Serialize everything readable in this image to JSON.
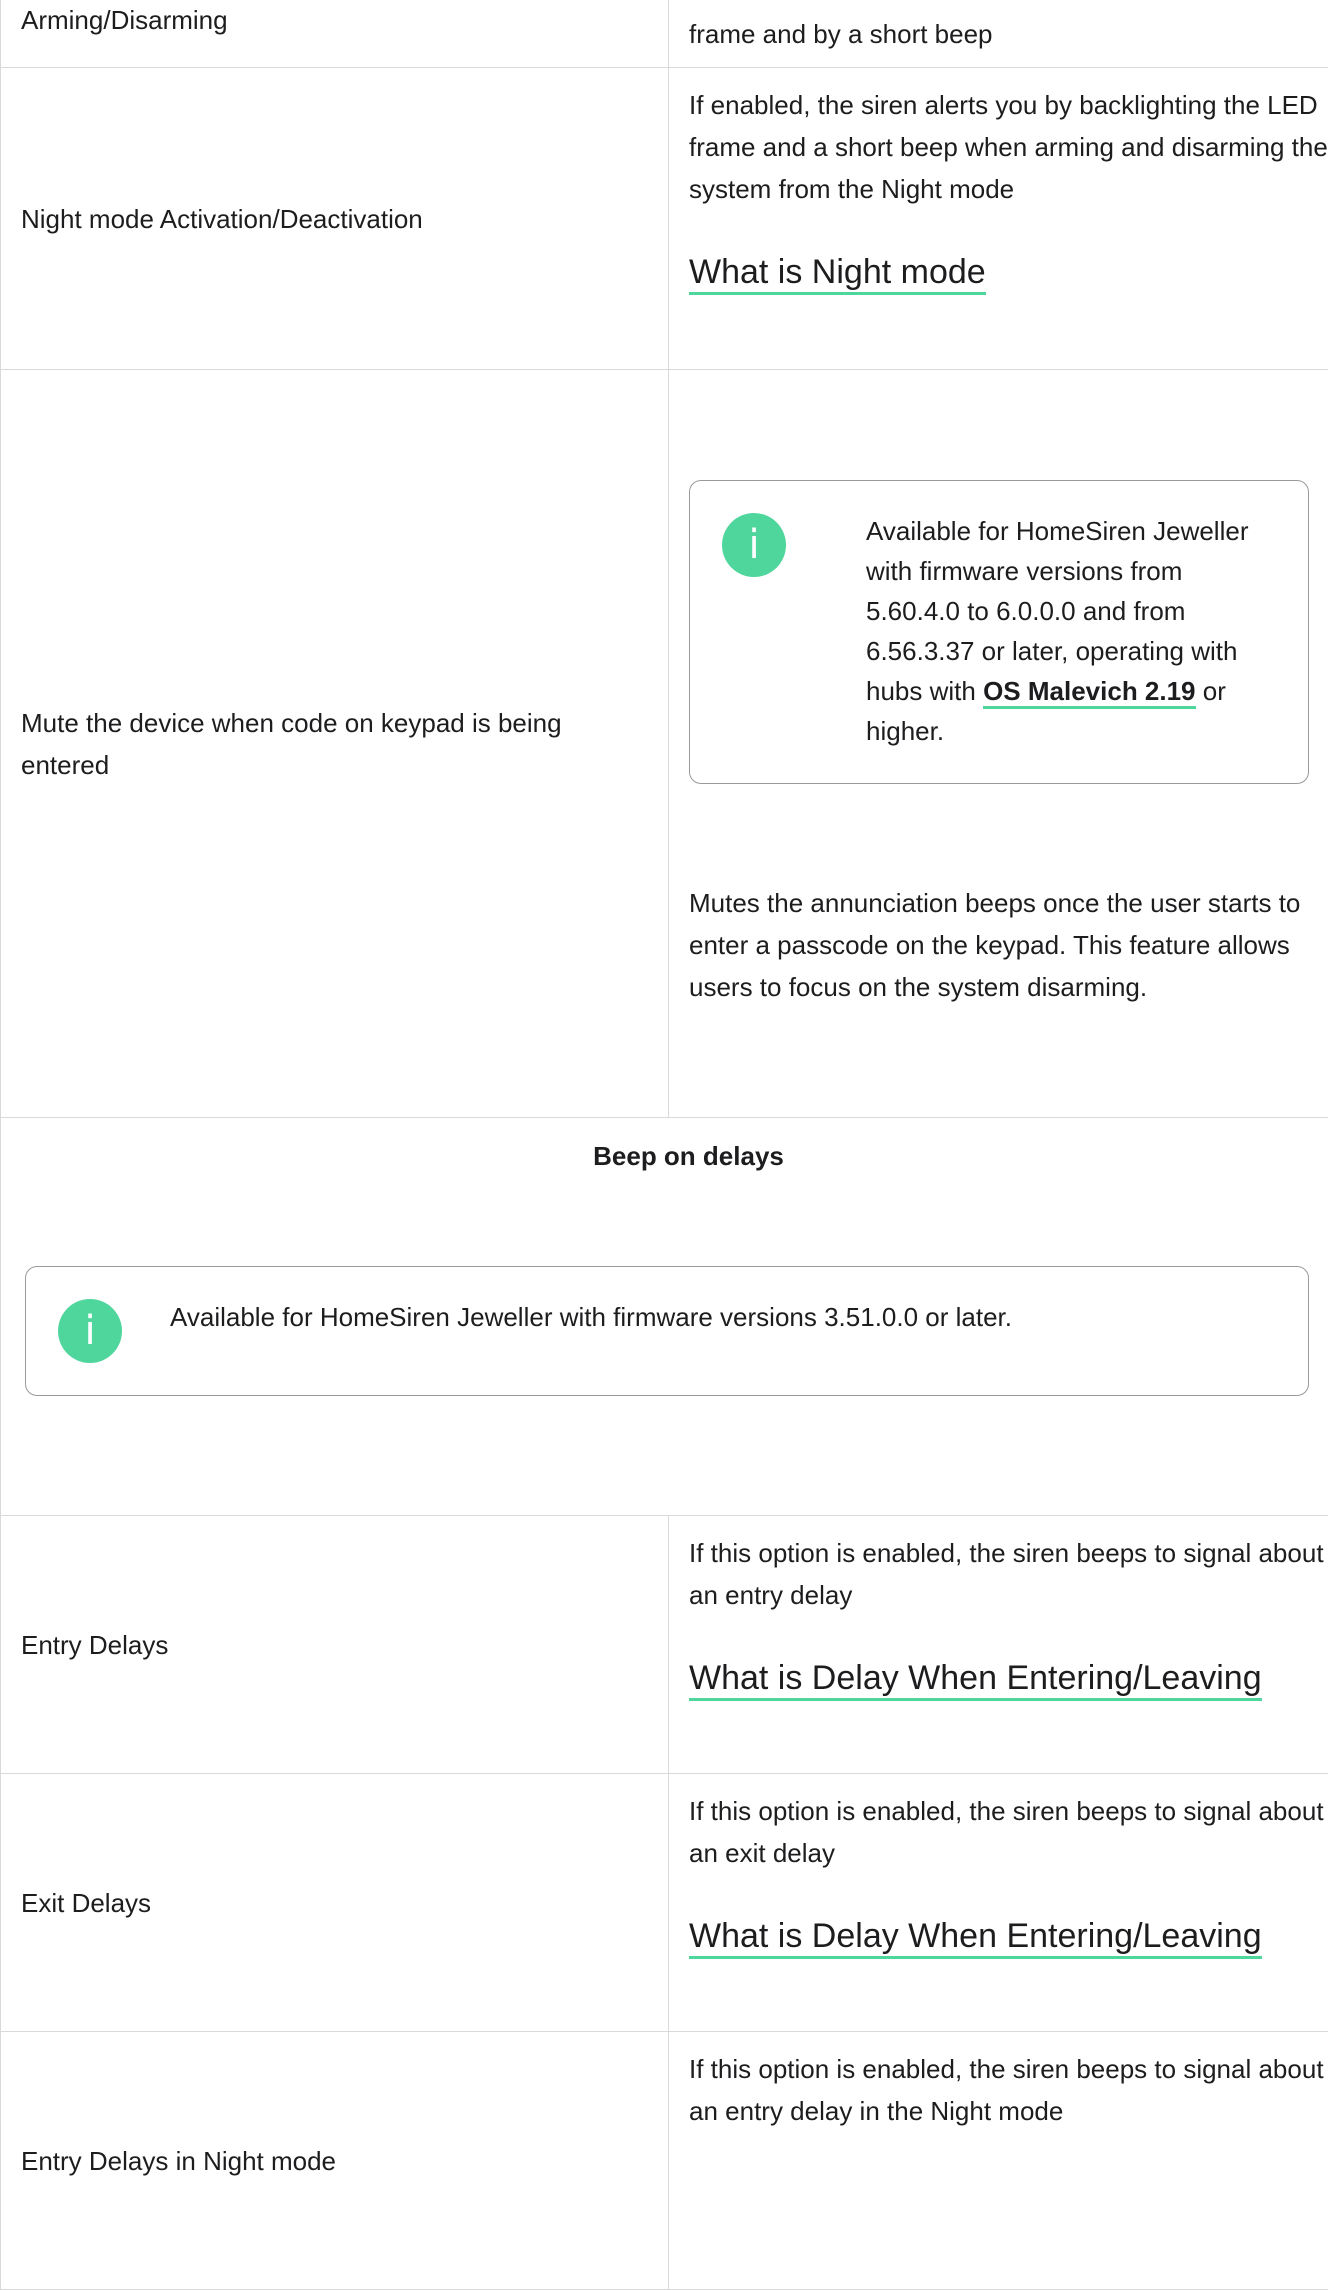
{
  "rows": {
    "prev": {
      "name": "Arming/Disarming",
      "desc_tail": "frame and by a short beep"
    },
    "night_mode": {
      "name": "Night mode Activation/Deactivation",
      "desc": "If enabled, the siren alerts you by backlighting the LED frame and a short beep when arming and disarming the system from the Night mode",
      "link": "What is Night mode"
    },
    "mute": {
      "name": "Mute the device when code on keypad is being entered",
      "note_before": "Available for HomeSiren Jeweller with firmware versions from 5.60.4.0 to 6.0.0.0 and from 6.56.3.37 or later, operating with hubs with ",
      "note_link": "OS Malevich 2.19",
      "note_after": " or higher.",
      "desc": "Mutes the annunciation beeps once the user starts to enter a passcode on the keypad. This feature allows users to focus on the system disarming."
    },
    "beep_section": {
      "title": "Beep on delays",
      "note": "Available for HomeSiren Jeweller with firmware versions 3.51.0.0 or later."
    },
    "entry": {
      "name": "Entry Delays",
      "desc": "If this option is enabled, the siren beeps to signal about an entry delay",
      "link": "What is Delay When Entering/Leaving"
    },
    "exit": {
      "name": "Exit Delays",
      "desc": "If this option is enabled, the siren beeps to signal about an exit delay",
      "link": "What is Delay When Entering/Leaving"
    },
    "entry_night": {
      "name": "Entry Delays in Night mode",
      "desc": "If this option is enabled, the siren beeps to signal about an entry delay in the Night mode"
    }
  },
  "icons": {
    "info": "info-icon",
    "info_glyph": "i"
  },
  "colors": {
    "accent": "#4fd69c",
    "border": "#d9d9d9",
    "box_border": "#9a9a9a",
    "text": "#1d1d1f"
  }
}
